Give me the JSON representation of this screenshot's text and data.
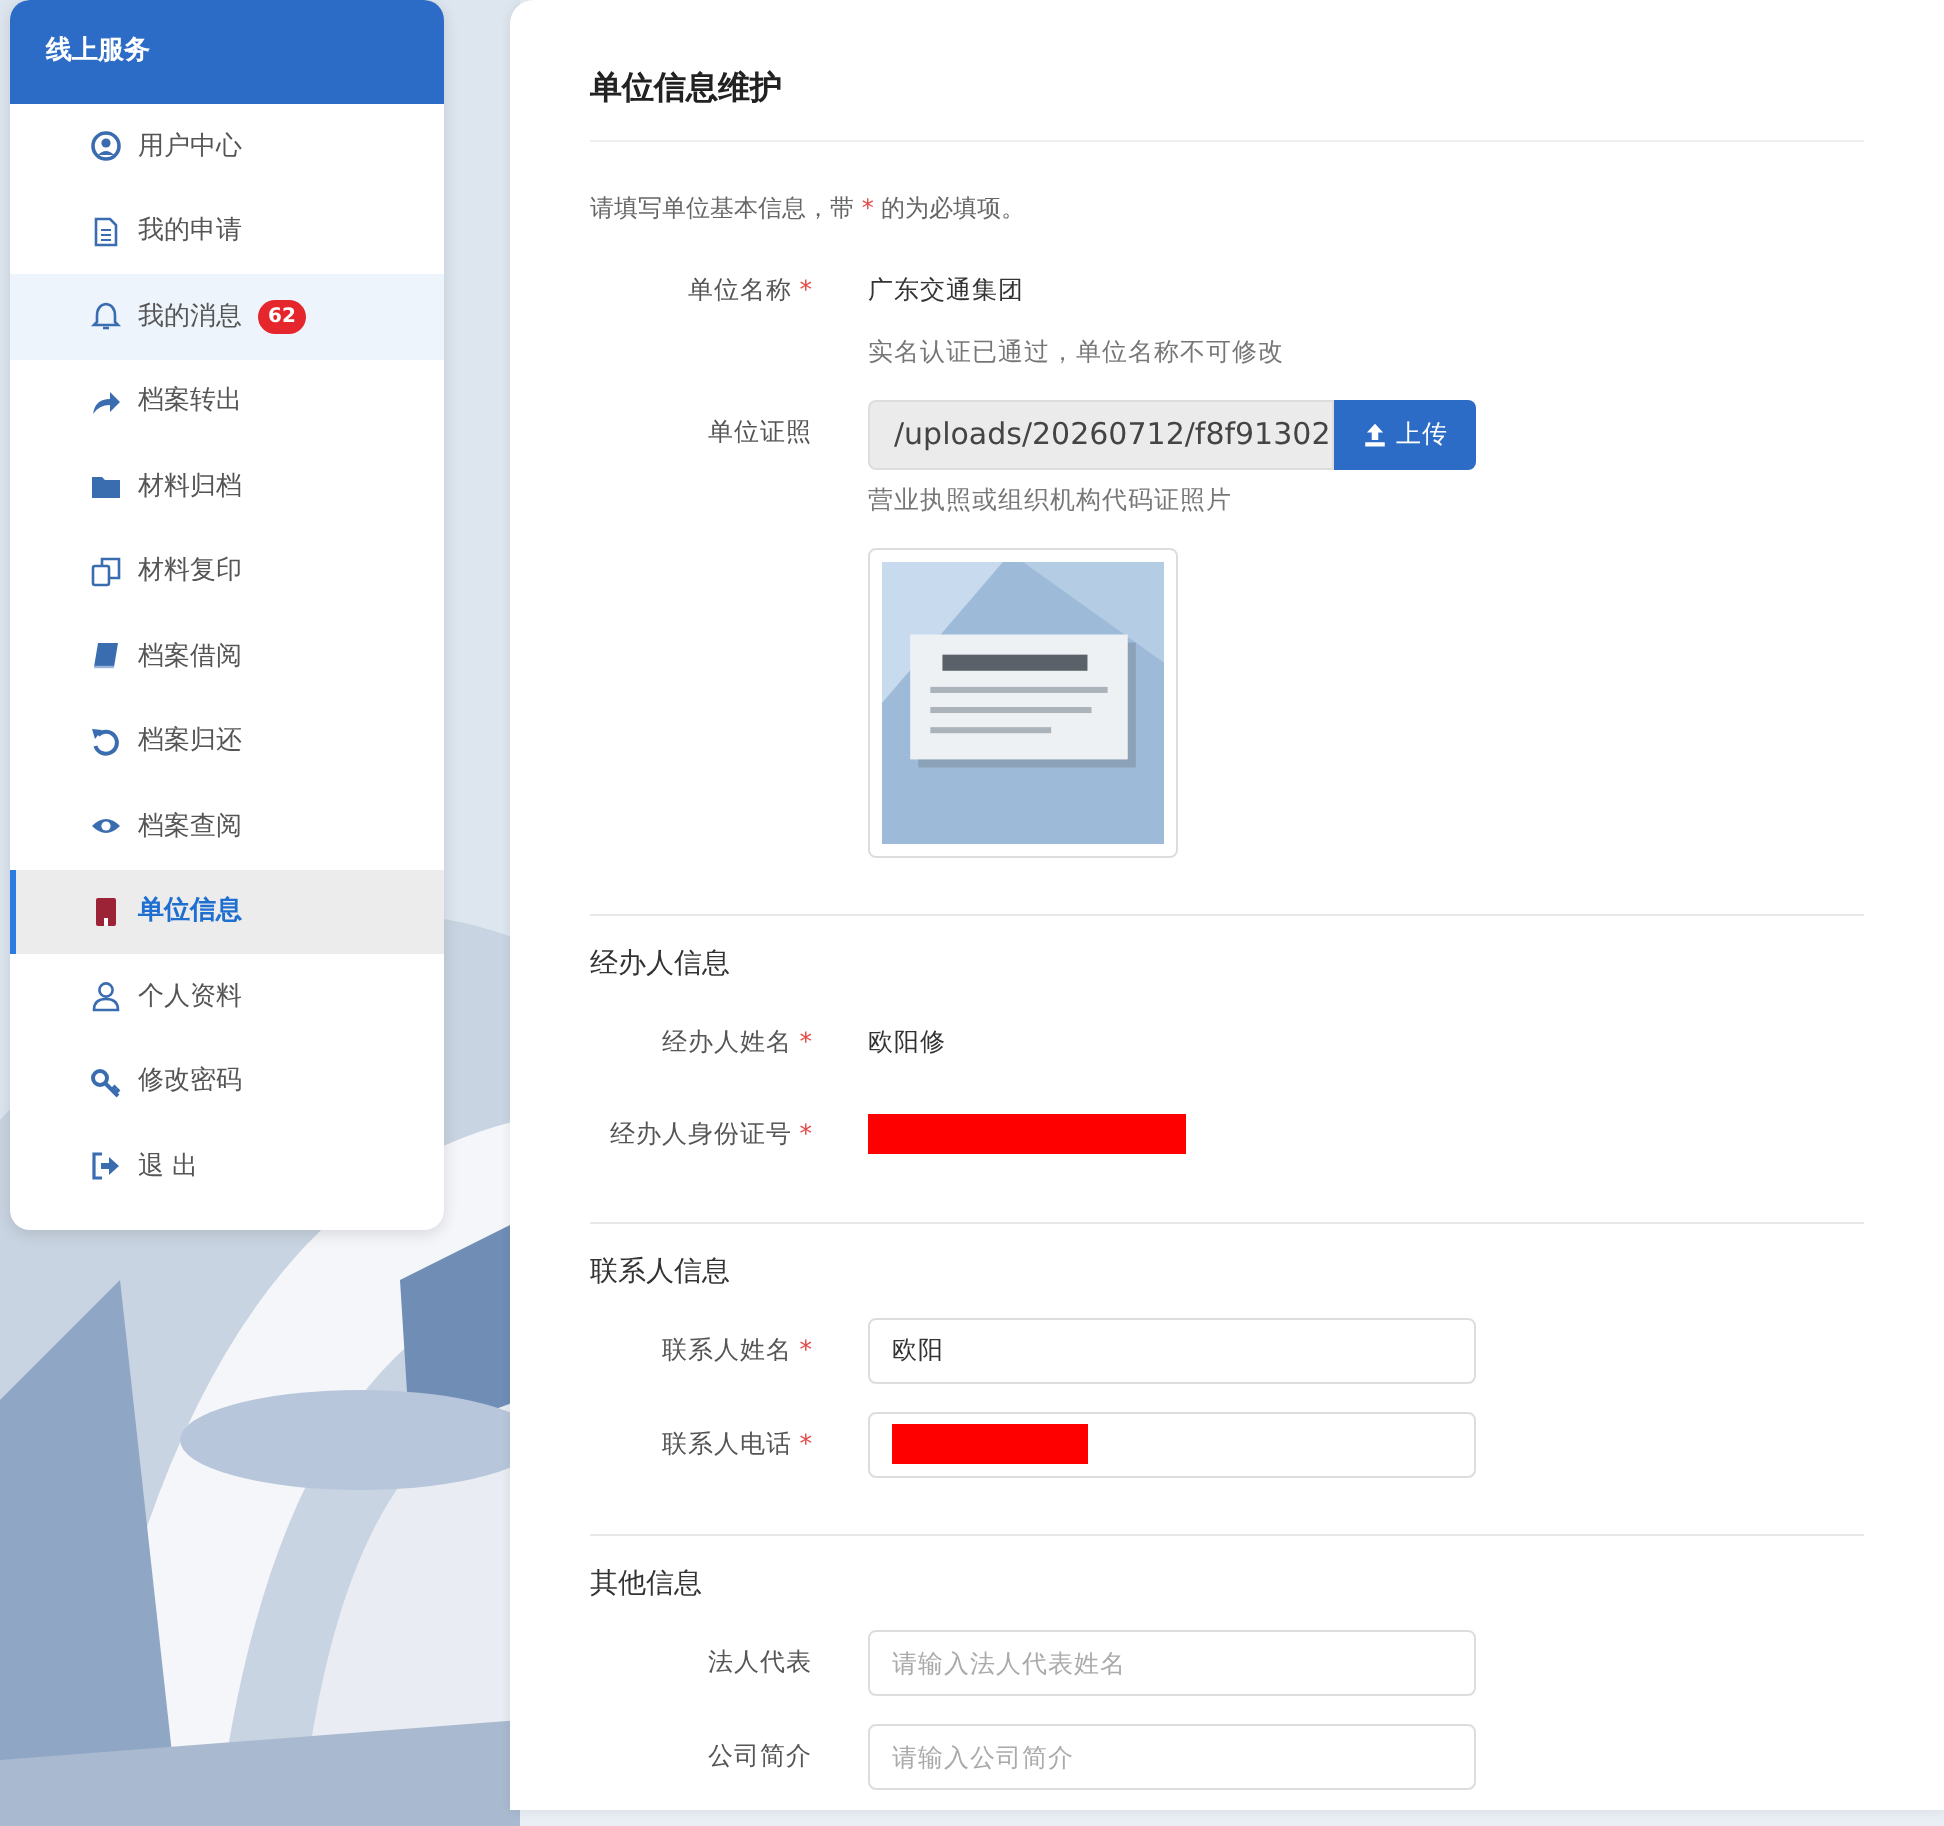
{
  "sidebar": {
    "title": "线上服务",
    "items": [
      {
        "label": "用户中心",
        "selected": false,
        "hovered": false
      },
      {
        "label": "我的申请",
        "selected": false,
        "hovered": false
      },
      {
        "label": "我的消息",
        "selected": false,
        "hovered": true,
        "badge": "62"
      },
      {
        "label": "档案转出",
        "selected": false,
        "hovered": false
      },
      {
        "label": "材料归档",
        "selected": false,
        "hovered": false
      },
      {
        "label": "材料复印",
        "selected": false,
        "hovered": false
      },
      {
        "label": "档案借阅",
        "selected": false,
        "hovered": false
      },
      {
        "label": "档案归还",
        "selected": false,
        "hovered": false
      },
      {
        "label": "档案查阅",
        "selected": false,
        "hovered": false
      },
      {
        "label": "单位信息",
        "selected": true,
        "hovered": false
      },
      {
        "label": "个人资料",
        "selected": false,
        "hovered": false
      },
      {
        "label": "修改密码",
        "selected": false,
        "hovered": false
      },
      {
        "label": "退 出",
        "selected": false,
        "hovered": false
      }
    ]
  },
  "page": {
    "title": "单位信息维护",
    "intro_before": "请填写单位基本信息，带",
    "required_mark": "*",
    "intro_after": "的为必填项。",
    "sections": [
      {
        "fields": [
          {
            "kind": "text",
            "label": "单位名称",
            "required": true,
            "value": "广东交通集团",
            "note": "实名认证已通过，单位名称不可修改"
          },
          {
            "kind": "file",
            "label": "单位证照",
            "required": false,
            "value": "/uploads/20260712/f8f91302",
            "button": "上传",
            "note": "营业执照或组织机构代码证照片"
          }
        ]
      },
      {
        "title": "经办人信息",
        "fields": [
          {
            "kind": "text",
            "label": "经办人姓名",
            "required": true,
            "value": "欧阳修"
          },
          {
            "kind": "redacted",
            "label": "经办人身份证号",
            "required": true
          }
        ]
      },
      {
        "title": "联系人信息",
        "fields": [
          {
            "kind": "input",
            "label": "联系人姓名",
            "required": true,
            "value": "欧阳"
          },
          {
            "kind": "input",
            "label": "联系人电话",
            "required": true,
            "redacted": true
          }
        ]
      },
      {
        "title": "其他信息",
        "fields": [
          {
            "kind": "input",
            "label": "法人代表",
            "required": false,
            "placeholder": "请输入法人代表姓名"
          },
          {
            "kind": "input",
            "label": "公司简介",
            "required": false,
            "placeholder": "请输入公司简介"
          }
        ]
      }
    ]
  }
}
